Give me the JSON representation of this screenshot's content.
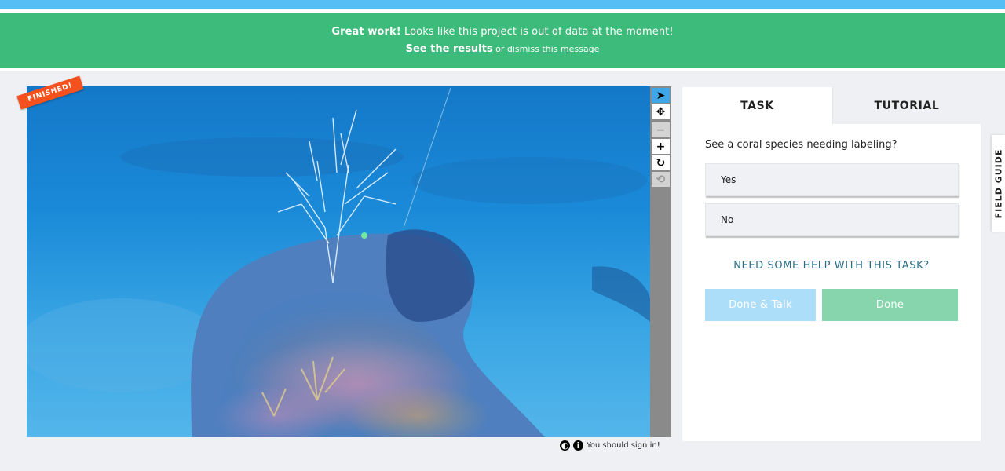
{
  "banner": {
    "strong": "Great work!",
    "message": " Looks like this project is out of data at the moment!",
    "results_link": "See the results",
    "or_text": " or ",
    "dismiss_link": "dismiss this message"
  },
  "viewer": {
    "ribbon": "FINISHED!",
    "image_description": "underwater seafloor with coral reef",
    "tools": [
      {
        "name": "annotate",
        "icon": "cursor-icon",
        "glyph": "➤"
      },
      {
        "name": "move",
        "icon": "move-icon",
        "glyph": "✥"
      },
      {
        "name": "zoom-out",
        "icon": "minus-icon",
        "glyph": "−"
      },
      {
        "name": "zoom-in",
        "icon": "plus-icon",
        "glyph": "+"
      },
      {
        "name": "rotate",
        "icon": "rotate-icon",
        "glyph": "↻"
      },
      {
        "name": "reset",
        "icon": "reset-icon",
        "glyph": "⟲"
      }
    ],
    "footer": {
      "contrast_icon": "◐",
      "info_icon": "i",
      "sign_in_text": "You should sign in!"
    }
  },
  "panel": {
    "tabs": [
      {
        "label": "TASK",
        "active": true
      },
      {
        "label": "TUTORIAL",
        "active": false
      }
    ],
    "question": "See a coral species needing labeling?",
    "answers": [
      "Yes",
      "No"
    ],
    "help": "NEED SOME HELP WITH THIS TASK?",
    "done_talk": "Done & Talk",
    "done": "Done"
  },
  "field_guide": "FIELD GUIDE",
  "colors": {
    "banner": "#3cbb7a",
    "top_strip": "#55bff5",
    "ribbon": "#f4511e",
    "done_talk": "#addef9",
    "done": "#87d5ad",
    "help_link": "#2a6e85"
  }
}
